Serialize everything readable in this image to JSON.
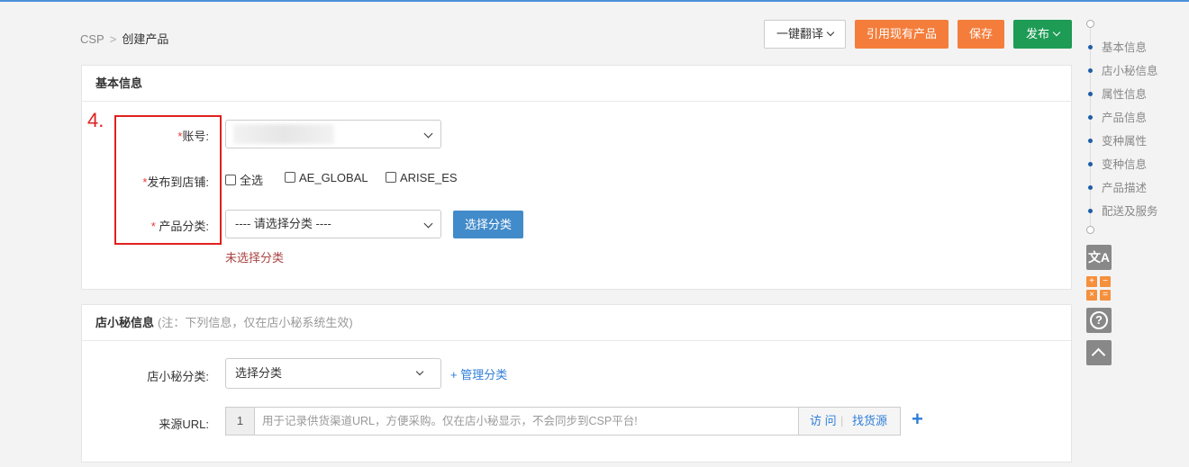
{
  "breadcrumb": {
    "root": "CSP",
    "separator": ">",
    "current": "创建产品"
  },
  "toolbar": {
    "translate_label": "一键翻译",
    "reference_label": "引用现有产品",
    "save_label": "保存",
    "publish_label": "发布"
  },
  "basic_info": {
    "title": "基本信息",
    "account": {
      "required_mark": "*",
      "label": "账号:"
    },
    "publish_store": {
      "required_mark": "*",
      "label": "发布到店铺:",
      "options": [
        {
          "label": "全选",
          "checked": false
        },
        {
          "label": "AE_GLOBAL",
          "checked": false
        },
        {
          "label": "ARISE_ES",
          "checked": false
        }
      ]
    },
    "category": {
      "required_mark": "*",
      "label": " 产品分类:",
      "selected": "---- 请选择分类 ----",
      "select_button": "选择分类",
      "error": "未选择分类"
    }
  },
  "annotation": {
    "step_number": "4."
  },
  "assistant_info": {
    "title": "店小秘信息",
    "note": "(注：下列信息，仅在店小秘系统生效)",
    "category": {
      "label": "店小秘分类:",
      "selected": "选择分类",
      "manage_link": "+ 管理分类"
    },
    "source_url": {
      "label": "来源URL:",
      "index": "1",
      "placeholder": "用于记录供货渠道URL，方便采购。仅在店小秘显示，不会同步到CSP平台!",
      "visit_label": "访 问",
      "divider": "|",
      "find_label": "找货源",
      "add_symbol": "+"
    }
  },
  "side_nav": {
    "items": [
      "基本信息",
      "店小秘信息",
      "属性信息",
      "产品信息",
      "变种属性",
      "变种信息",
      "产品描述",
      "配送及服务"
    ]
  },
  "tools": {
    "translate_glyph": "文A",
    "calc_glyphs": [
      "+",
      "−",
      "×",
      "="
    ],
    "help_glyph": "?"
  },
  "colors": {
    "accent_blue": "#428bca",
    "orange": "#f47d3b",
    "green": "#1e9b55",
    "highlight_red": "#e02020"
  }
}
